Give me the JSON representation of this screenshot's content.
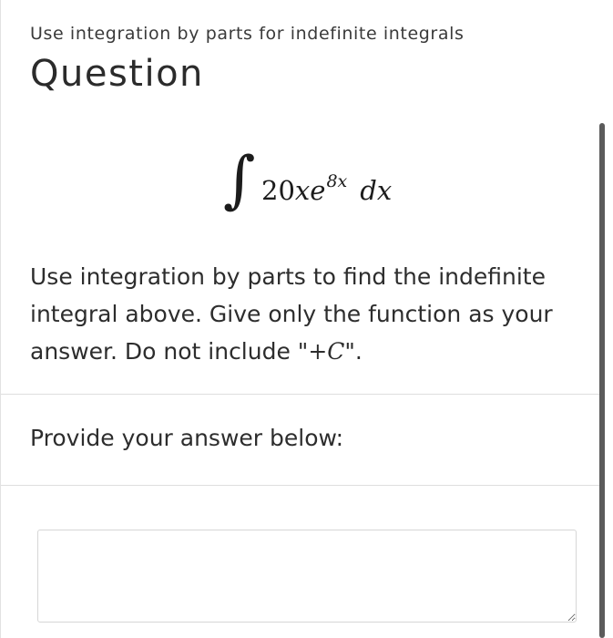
{
  "topic": "Use integration by parts for indefinite integrals",
  "heading": "Question",
  "formula": {
    "integral_sign": "∫",
    "coefficient": "20",
    "variable": "x",
    "base": "e",
    "exponent": "8x",
    "differential": "dx"
  },
  "instructions": {
    "line1": "Use integration by parts to find the indefinite",
    "line2": "integral above. Give only the function as your",
    "line3_prefix": "answer. Do not include \"",
    "plus": "+",
    "constant": "C",
    "line3_suffix": "\"."
  },
  "answer_prompt": "Provide your answer below:",
  "answer_input": {
    "value": "",
    "placeholder": ""
  }
}
